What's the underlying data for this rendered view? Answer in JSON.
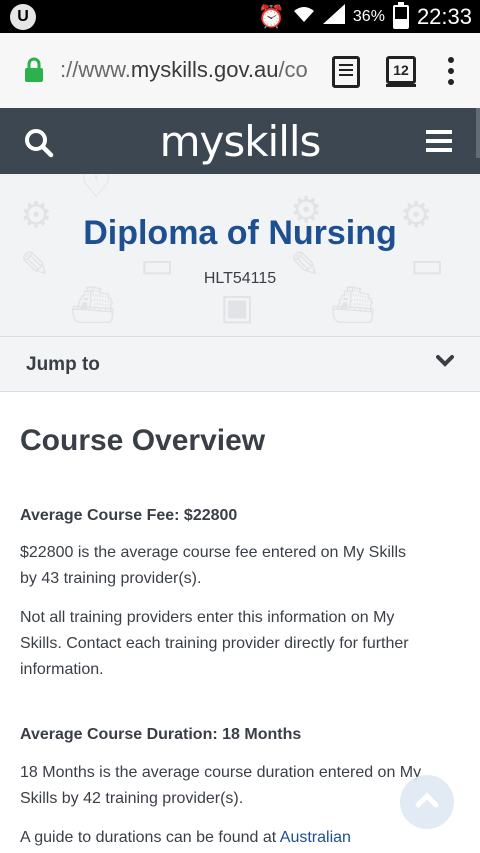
{
  "status_bar": {
    "left_icon_label": "U",
    "battery_percent": "36%",
    "time": "22:33"
  },
  "browser": {
    "url_prefix": "://www.",
    "url_host": "myskills.gov.au",
    "url_rest": "/co",
    "tab_count": "12"
  },
  "site": {
    "logo_text": "myskills"
  },
  "hero": {
    "title": "Diploma of Nursing",
    "code": "HLT54115"
  },
  "jump": {
    "label": "Jump to"
  },
  "overview": {
    "title": "Course Overview",
    "fee_heading": "Average Course Fee: $22800",
    "fee_line1": "$22800 is the average course fee entered on My Skills",
    "fee_line2": "by 43 training provider(s).",
    "note_line1": "Not all training providers enter this information on My",
    "note_line2": "Skills. Contact each training provider directly for further",
    "note_line3": "information.",
    "duration_heading": "Average Course Duration: 18 Months",
    "duration_line1": "18 Months is the average course duration entered on My",
    "duration_line2": "Skills by 42 training provider(s).",
    "guide_text": "A guide to durations can be found at ",
    "guide_link": "Australian"
  },
  "colors": {
    "header_bg": "#3d4752",
    "title_blue": "#1d4f91",
    "lock_green": "#2bb24c"
  }
}
